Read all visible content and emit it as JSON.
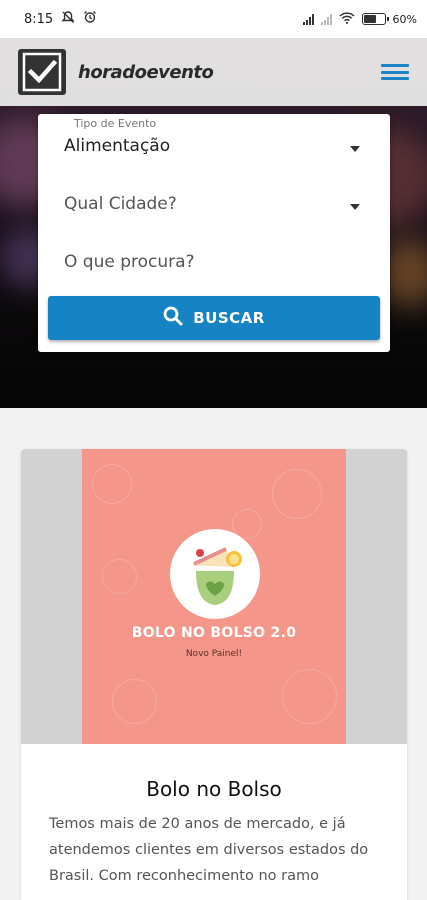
{
  "status_bar": {
    "time": "8:15",
    "battery_percent": "60%",
    "battery_level": 0.6,
    "icons": [
      "notification-muted-icon",
      "alarm-icon",
      "signal-icon",
      "wifi-icon",
      "battery-icon"
    ]
  },
  "header": {
    "logo_text": "horadoevento",
    "logo_icon": "checkmark-icon",
    "menu_icon": "hamburger-menu-icon",
    "accent_color": "#1a84c7"
  },
  "search": {
    "event_type_label": "Tipo de Evento",
    "event_type_value": "Alimentação",
    "city_placeholder": "Qual Cidade?",
    "query_placeholder": "O que procura?",
    "button_label": "BUSCAR",
    "button_color": "#1683c4"
  },
  "event": {
    "banner_title": "BOLO NO BOLSO 2.0",
    "banner_subtitle": "Novo Painel!",
    "banner_color": "#f4968a",
    "title": "Bolo no Bolso",
    "description": "Temos mais de 20 anos de mercado, e já atendemos clientes em diversos estados do Brasil. Com reconhecimento no ramo"
  }
}
